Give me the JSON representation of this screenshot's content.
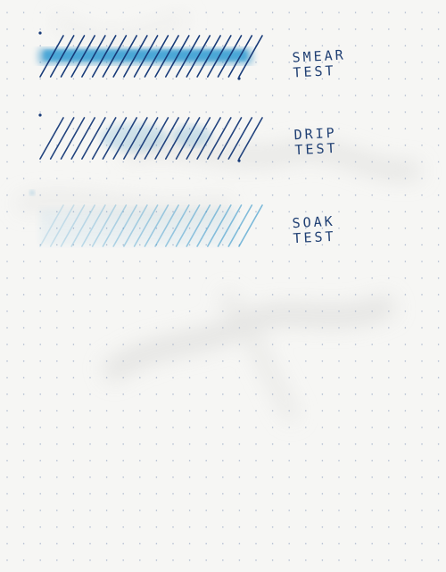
{
  "paper": {
    "background": "#f6f6f4",
    "dot_color": "#8fa0bf"
  },
  "ink": {
    "dark_blue": "#173a78",
    "turquoise": "#2e93c9",
    "smear_highlight": "#3fa3d6",
    "label_blue": "#1f3f73"
  },
  "tests": [
    {
      "label": "SMEAR\nTEST",
      "condition": "smear",
      "line_strength": 1.0,
      "wash": "heavy"
    },
    {
      "label": "DRIP\nTEST",
      "condition": "drip",
      "line_strength": 0.95,
      "wash": "light"
    },
    {
      "label": "SOAK\nTEST",
      "condition": "soak",
      "line_strength": 0.35,
      "wash": "faded"
    }
  ]
}
